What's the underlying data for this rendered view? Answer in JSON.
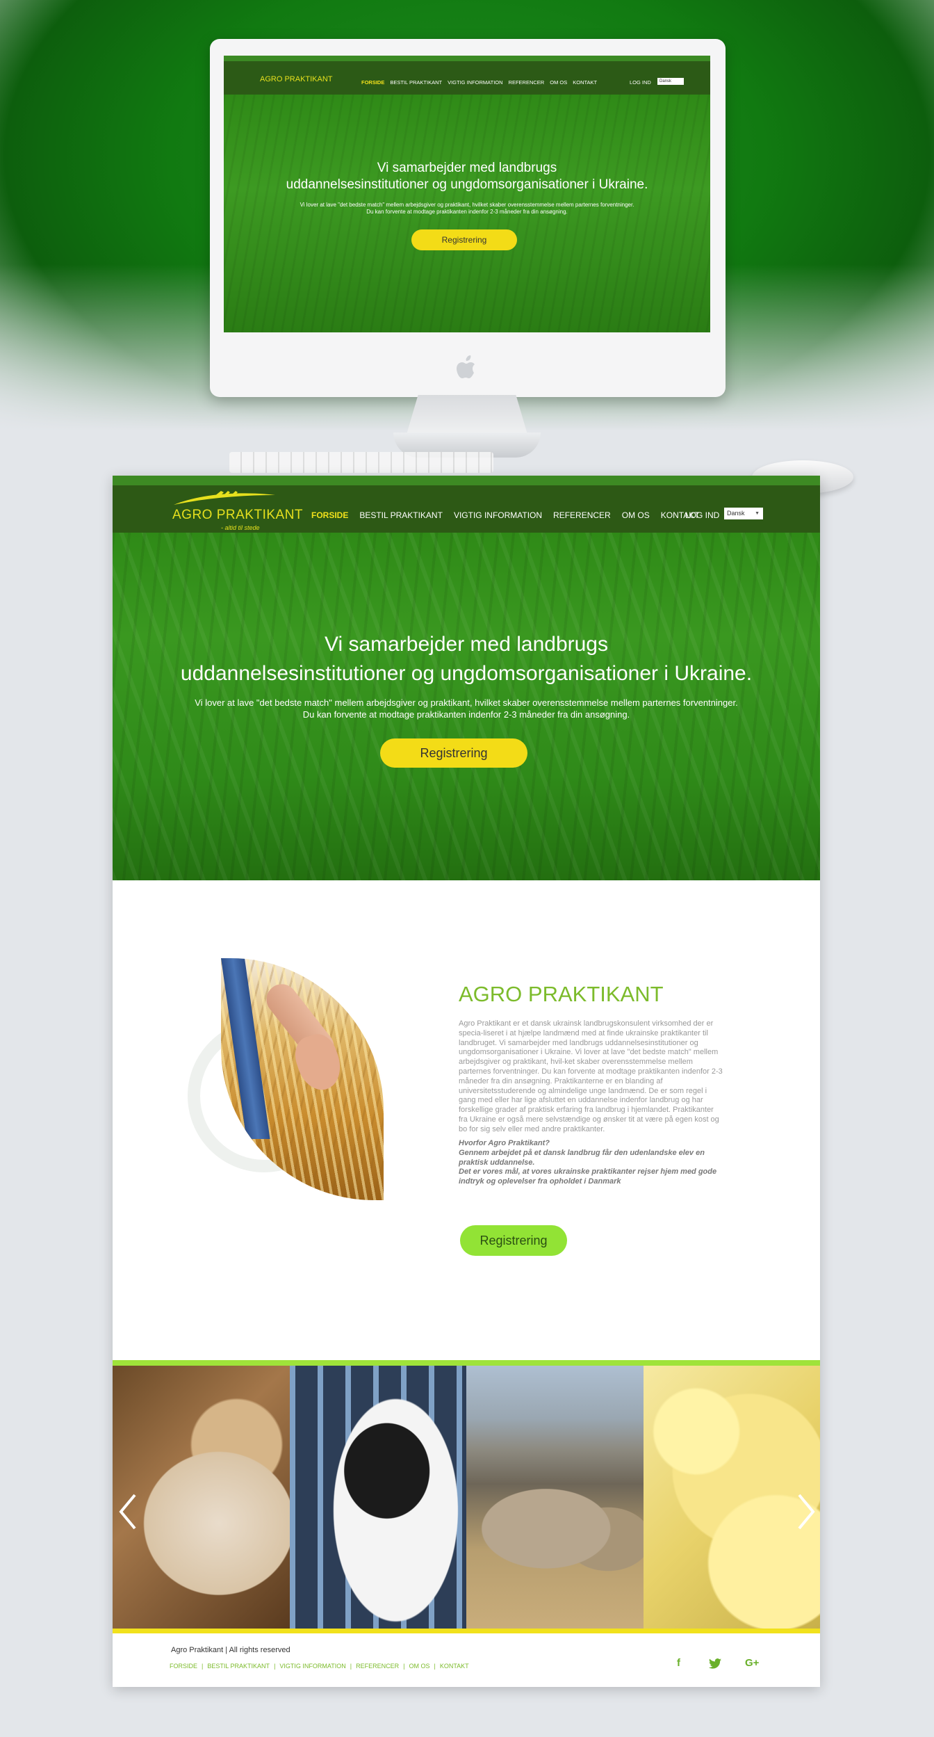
{
  "brand": {
    "name_part1": "AGRO",
    "name_part2": "PRAKTIKANT",
    "tagline": "- altid til stede"
  },
  "colors": {
    "nav_green": "#2d5915",
    "accent_yellow": "#f3dc17",
    "accent_lime": "#92e335",
    "title_green": "#7cbb2b"
  },
  "nav": {
    "items": [
      "FORSIDE",
      "BESTIL PRAKTIKANT",
      "VIGTIG INFORMATION",
      "REFERENCER",
      "OM OS",
      "KONTAKT"
    ],
    "active": "FORSIDE",
    "login": "LOG IND",
    "language": "Dansk"
  },
  "hero": {
    "title_line1": "Vi samarbejder med landbrugs",
    "title_line2": "uddannelsesinstitutioner og ungdomsorganisationer i Ukraine.",
    "text_line1": "Vi lover at lave \"det bedste match\" mellem arbejdsgiver og praktikant, hvilket skaber overensstemmelse mellem parternes forventninger.",
    "text_line2": "Du kan forvente at modtage praktikanten indenfor 2-3 måneder fra din ansøgning.",
    "button": "Registrering"
  },
  "about": {
    "title": "AGRO PRAKTIKANT",
    "text": "Agro Praktikant er et dansk ukrainsk landbrugskonsulent virksomhed der er specia-liseret i at hjælpe landmænd med at finde ukrainske praktikanter til landbruget. Vi samarbejder med landbrugs uddannelsesinstitutioner og ungdomsorganisationer i Ukraine. Vi lover at lave \"det bedste match\" mellem arbejdsgiver og praktikant, hvil-ket skaber overensstemmelse mellem parternes forventninger. Du kan forvente at modtage praktikanten indenfor 2-3 måneder fra din ansøgning. Praktikanterne er en blanding af universitetsstuderende og almindelige unge landmænd. De er som regel i gang med eller har lige afsluttet en uddannelse indenfor landbrug og har forskellige grader af praktisk erfaring fra landbrug i hjemlandet. Praktikanter fra Ukraine er også mere selvstændige og ønsker tit at være på egen kost og bo for sig selv eller med andre praktikanter.",
    "question": "Hvorfor Agro Praktikant?",
    "answer1": "Gennem arbejdet på et dansk landbrug får den udenlandske elev en praktisk uddannelse.",
    "answer2": "Det er vores mål, at vores ukrainske praktikanter rejser hjem med gode indtryk og oplevelser fra opholdet i Danmark",
    "button": "Registrering"
  },
  "gallery": {
    "photos": [
      "goat",
      "cow",
      "sheep",
      "chicks"
    ],
    "prev_icon": "chevron-left-icon",
    "next_icon": "chevron-right-icon"
  },
  "footer": {
    "copyright": "Agro Praktikant  |  All rights reserved",
    "links": [
      "FORSIDE",
      "BESTIL PRAKTIKANT",
      "VIGTIG INFORMATION",
      "REFERENCER",
      "OM OS",
      "KONTAKT"
    ],
    "separator": "|",
    "social": {
      "facebook": "f",
      "twitter": "twitter-bird",
      "google_plus": "G+"
    }
  },
  "mini": {
    "brand": "AGRO PRAKTIKANT",
    "login": "LOG IND",
    "language": "Dansk",
    "title_line1": "Vi samarbejder med landbrugs",
    "title_line2": "uddannelsesinstitutioner og ungdomsorganisationer i Ukraine.",
    "text_line1": "Vi lover at lave \"det bedste match\" mellem arbejdsgiver og praktikant, hvilket skaber overensstemmelse mellem parternes forventninger.",
    "text_line2": "Du kan forvente at modtage praktikanten indenfor 2-3 måneder fra din ansøgning.",
    "button": "Registrering"
  }
}
